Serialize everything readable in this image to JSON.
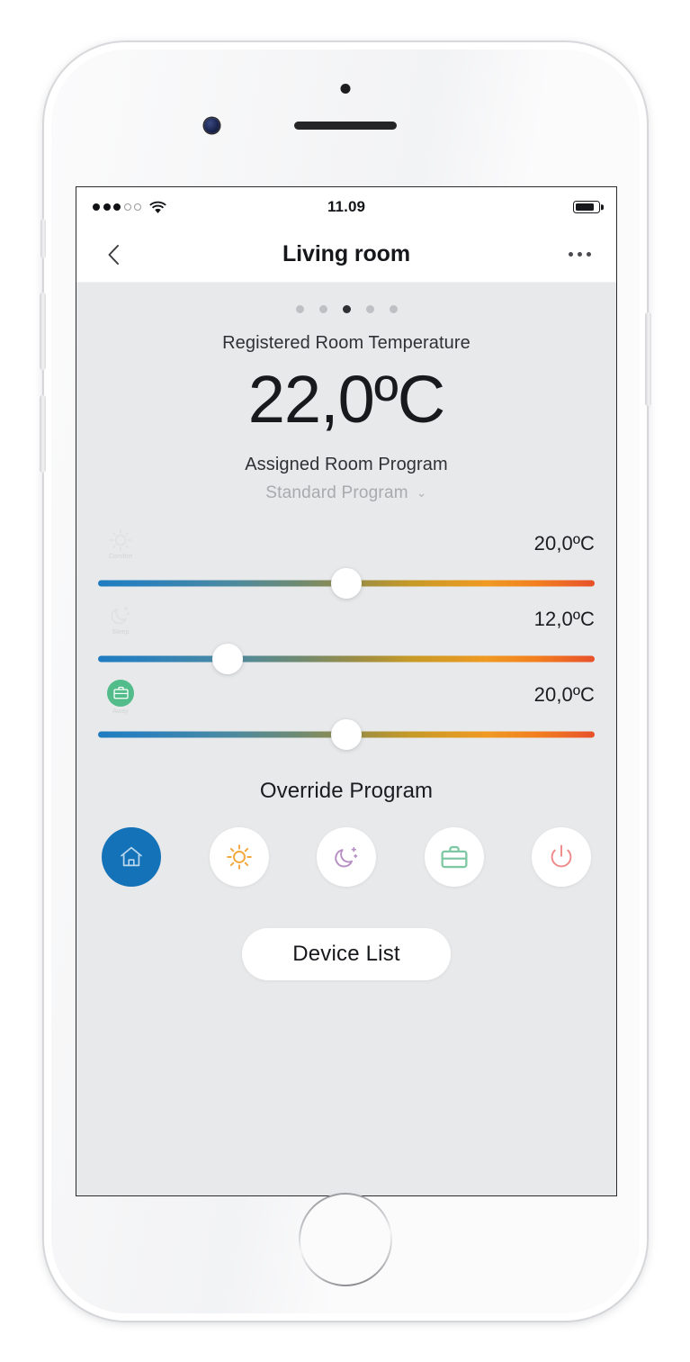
{
  "status_bar": {
    "signal_filled": 3,
    "signal_empty": 2,
    "wifi_icon": "wifi-icon",
    "time": "11.09",
    "battery_icon": "battery-icon",
    "battery_level_pct": 82
  },
  "nav": {
    "back_icon": "chevron-left-icon",
    "title": "Living room",
    "more_icon": "more-options-icon"
  },
  "pager": {
    "count": 5,
    "active_index": 2
  },
  "readout": {
    "label": "Registered Room Temperature",
    "value": "22,0ºC"
  },
  "program": {
    "label": "Assigned Room Program",
    "selected": "Standard Program",
    "chevron": "⌄"
  },
  "sliders": [
    {
      "icon": "sun-icon",
      "caption": "Comfort",
      "value": "20,0ºC",
      "position_pct": 50,
      "badge": false
    },
    {
      "icon": "moon-icon",
      "caption": "Sleep",
      "value": "12,0ºC",
      "position_pct": 26,
      "badge": false
    },
    {
      "icon": "briefcase-icon",
      "caption": "Away",
      "value": "20,0ºC",
      "position_pct": 50,
      "badge": true,
      "badge_color": "#52bd8a"
    }
  ],
  "override": {
    "title": "Override Program",
    "buttons": [
      {
        "icon": "home-icon",
        "color": "#ffffff",
        "active": true
      },
      {
        "icon": "sun-icon",
        "color": "#f3a83c",
        "active": false
      },
      {
        "icon": "moon-icon",
        "color": "#b78fc4",
        "active": false
      },
      {
        "icon": "briefcase-icon",
        "color": "#7fc8a4",
        "active": false
      },
      {
        "icon": "power-icon",
        "color": "#ef8b8b",
        "active": false
      }
    ]
  },
  "footer": {
    "device_list_label": "Device List"
  },
  "colors": {
    "accent_blue": "#1472b8",
    "screen_bg": "#e8e9ea",
    "bar_bg": "#ffffff",
    "track_cold": "#1f7cc0",
    "track_hot": "#e8512b"
  }
}
